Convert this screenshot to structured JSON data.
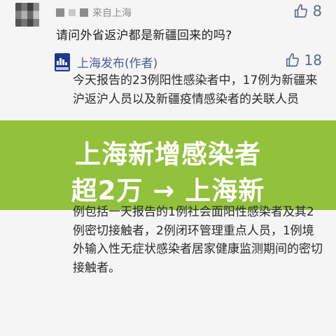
{
  "top_comment": {
    "user_masked": "·",
    "source": "来自上海",
    "likes": "8",
    "text": "请问外省返沪都是新疆回来的吗?"
  },
  "reply": {
    "author": "上海发布(作者)",
    "likes": "18",
    "text_top": "今天报告的23例阳性感染者中，17例为新疆来沪返沪人员以及新疆疫情感染者的关联人员",
    "text_bottom": "例包括一天报告的1例社会面阳性感染者及其2例密切接触者，2例闭环管理重点人员，1例境外输入性无症状感染者居家健康监测期间的密切接触者。"
  },
  "banner": {
    "line1": "上海新增感染者",
    "line2": "超2万 → 上海新"
  },
  "colors": {
    "banner_bg": "#92c13b",
    "link_blue": "#4a5d8f",
    "like_color": "#5c6b8a"
  },
  "icons": [
    "thumbs-up-icon",
    "publisher-avatar-icon"
  ]
}
